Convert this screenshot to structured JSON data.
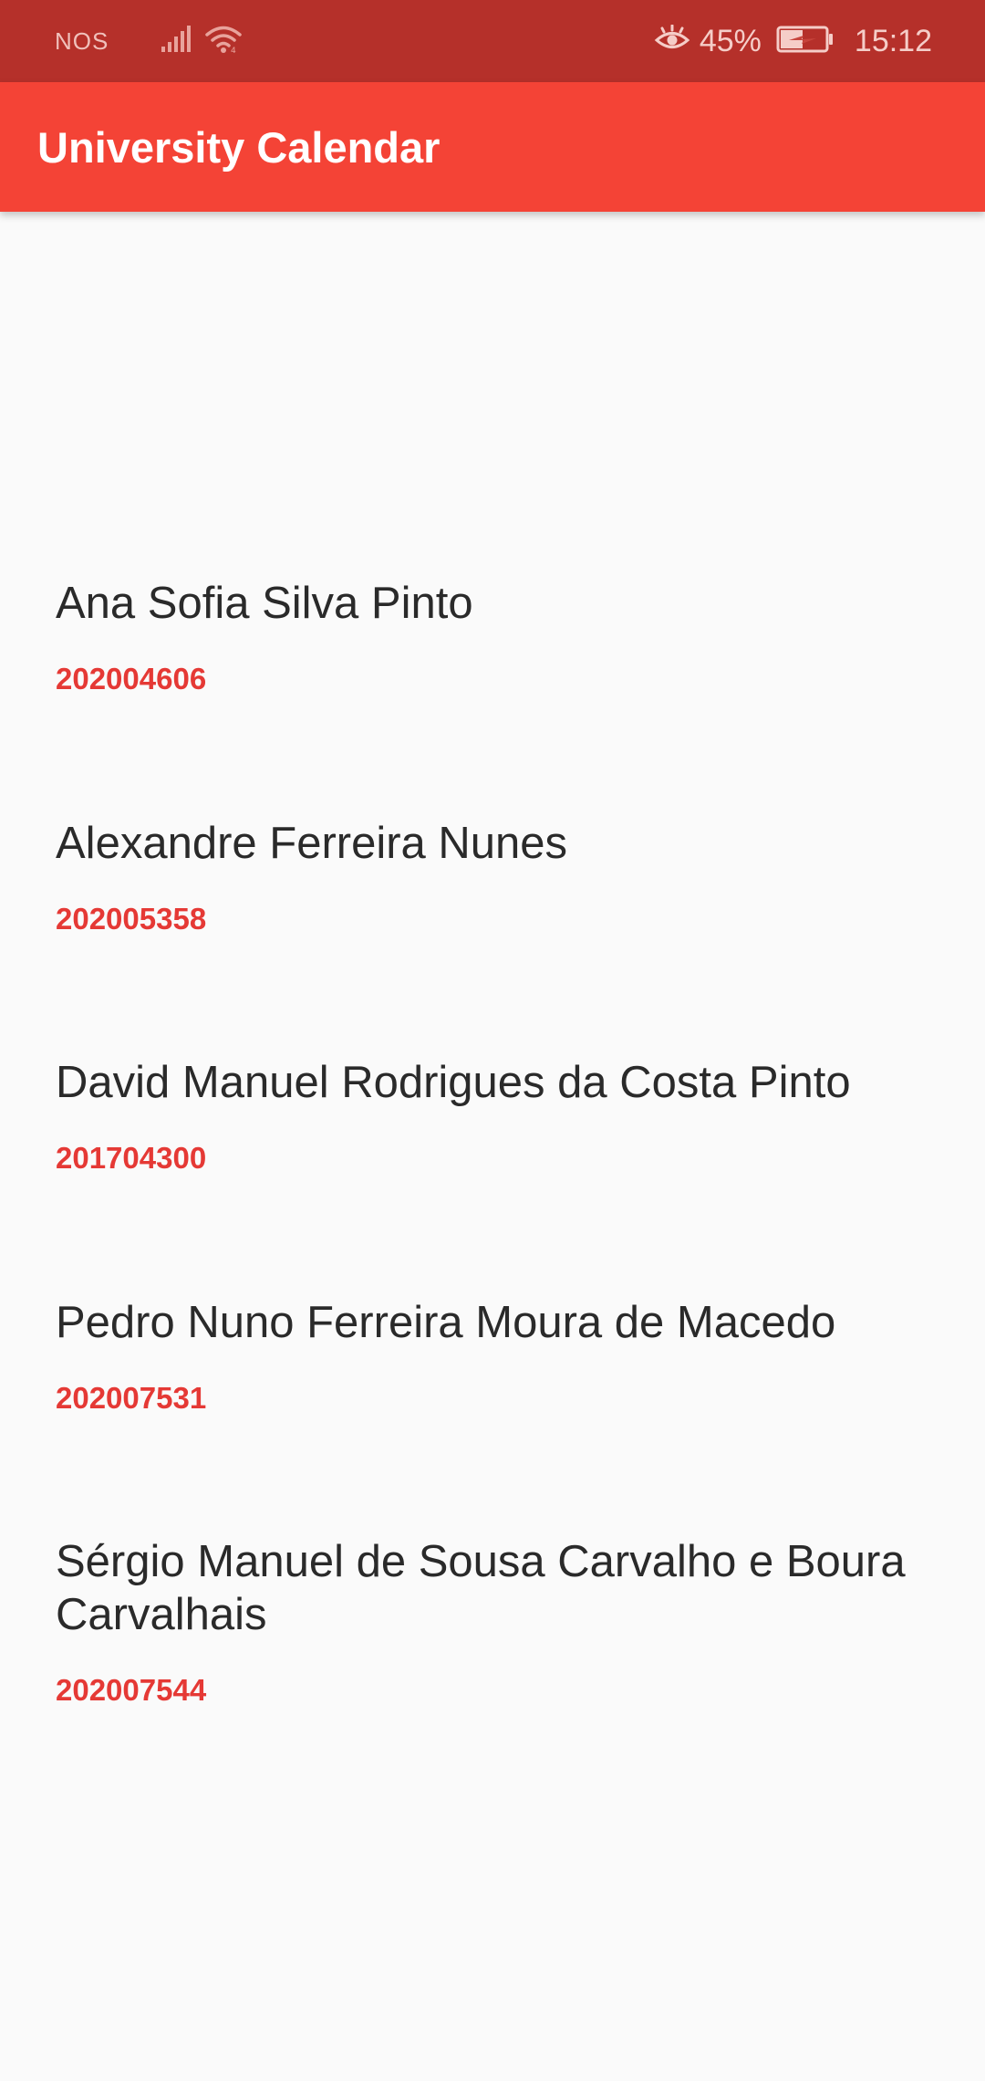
{
  "status_bar": {
    "carrier": "NOS",
    "battery": "45%",
    "time": "15:12",
    "icons": [
      "signal-icon",
      "wifi-icon",
      "eye-comfort-icon",
      "battery-charging-icon"
    ]
  },
  "app_bar": {
    "title": "University Calendar"
  },
  "members": [
    {
      "name": "Ana Sofia Silva Pinto",
      "id": "202004606"
    },
    {
      "name": "Alexandre Ferreira Nunes",
      "id": "202005358"
    },
    {
      "name": "David Manuel Rodrigues da Costa Pinto",
      "id": "201704300"
    },
    {
      "name": "Pedro Nuno Ferreira Moura de Macedo",
      "id": "202007531"
    },
    {
      "name": "Sérgio Manuel de Sousa Carvalho e Boura Carvalhais",
      "id": "202007544"
    }
  ],
  "colors": {
    "status_bar": "#b5302a",
    "app_bar": "#f44336",
    "accent": "#e53935",
    "background": "#fafafa",
    "text": "#2a2a2a"
  }
}
